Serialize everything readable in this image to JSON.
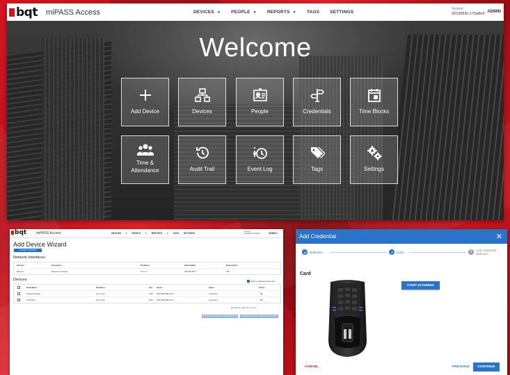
{
  "app": {
    "logo": "bqt",
    "name": "miPASS Access",
    "menu": [
      "DEVICES",
      "PEOPLE",
      "REPORTS",
      "TAGS",
      "SETTINGS"
    ],
    "version_label": "Version",
    "version": "20230830.175a8e9",
    "user": "ADMIN"
  },
  "welcome": {
    "title": "Welcome",
    "tiles": [
      {
        "label": "Add Device",
        "icon": "plus-icon"
      },
      {
        "label": "Devices",
        "icon": "network-icon"
      },
      {
        "label": "People",
        "icon": "id-card-icon"
      },
      {
        "label": "Credentials",
        "icon": "signpost-icon"
      },
      {
        "label": "Time Blocks",
        "icon": "calendar-icon"
      },
      {
        "label": "Time & Attendance",
        "icon": "group-icon"
      },
      {
        "label": "Audit Trail",
        "icon": "history-icon"
      },
      {
        "label": "Event Log",
        "icon": "event-log-icon"
      },
      {
        "label": "Tags",
        "icon": "tags-icon"
      },
      {
        "label": "Settings",
        "icon": "gears-icon"
      }
    ]
  },
  "wizard": {
    "title": "Add Device Wizard",
    "start_scanning": "START SCANNING",
    "network_title": "Network Interfaces",
    "network_headers": [
      "Interface",
      "Description",
      "IP Address",
      "Subnet Mask",
      "Network Size"
    ],
    "network_rows": [
      [
        "Ethernet",
        "Ethernet Connection",
        "10.0.1.1",
        "255.255.255.0",
        "256"
      ]
    ],
    "devices_title": "Devices",
    "filter_label": "Filter to selected devices only",
    "device_headers": [
      "Serial Name",
      "IP Address",
      "Port",
      "Device",
      "Status",
      "Library"
    ],
    "device_rows": [
      [
        "Enrolment Station",
        "10.0.1.100",
        "4001",
        "SKD-5000-DEV-S-P4",
        "Connected",
        "Bio"
      ],
      [
        "Front Door",
        "10.0.1.105",
        "4001",
        "SKD-5000-DEV-S-P4",
        "Connected",
        "Bio"
      ]
    ],
    "pager": "Records per page: 25  ▾   1-2 of 2",
    "btn_without_config": "ADD DEVICE WITHOUT CONFIGURATION",
    "btn_configure": "ADD DEVICE AND CONFIGURE SELECTED"
  },
  "dialog": {
    "title": "Add Credential",
    "close": "✕",
    "steps": [
      {
        "label": "Definition"
      },
      {
        "label": "Card"
      },
      {
        "number": "3",
        "label": "Link credential",
        "sub": "Optional"
      }
    ],
    "section": "Card",
    "start_scanning": "START SCANNING",
    "cancel": "CANCEL",
    "previous": "PREVIOUS",
    "continue": "CONTINUE"
  },
  "colors": {
    "brand_red": "#d0131c",
    "primary_blue": "#2a73c9"
  }
}
